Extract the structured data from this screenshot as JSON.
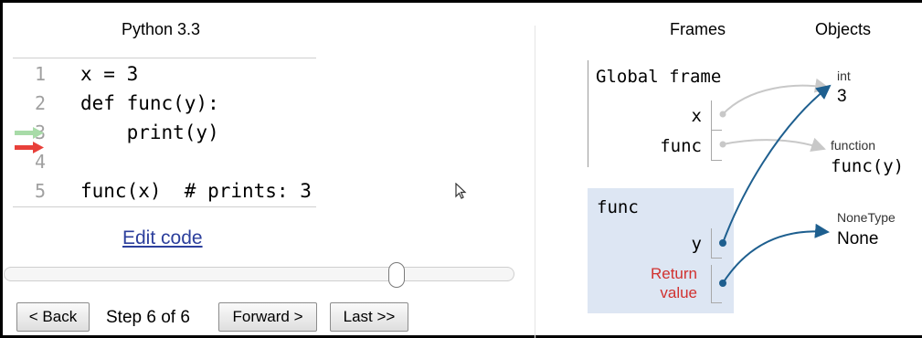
{
  "header": {
    "language": "Python 3.3",
    "frames_label": "Frames",
    "objects_label": "Objects"
  },
  "code": {
    "lines": [
      {
        "num": "1",
        "text": "x = 3"
      },
      {
        "num": "2",
        "text": "def func(y):"
      },
      {
        "num": "3",
        "text": "    print(y)"
      },
      {
        "num": "4",
        "text": ""
      },
      {
        "num": "5",
        "text": "func(x)  # prints: 3"
      }
    ],
    "prev_line_arrow_color": "#a8dba8",
    "current_line_arrow_color": "#e8403a"
  },
  "controls": {
    "edit_code": "Edit code",
    "back": "< Back",
    "step": "Step 6 of 6",
    "forward": "Forward >",
    "last": "Last >>",
    "slider_fraction": 1.0
  },
  "frames": {
    "global": {
      "title": "Global frame",
      "vars": [
        {
          "name": "x"
        },
        {
          "name": "func"
        }
      ]
    },
    "func": {
      "title": "func",
      "vars": [
        {
          "name": "y"
        }
      ],
      "return_line1": "Return",
      "return_line2": "value"
    }
  },
  "objects": {
    "int_obj": {
      "type": "int",
      "value": "3"
    },
    "function_obj": {
      "type": "function",
      "value": "func(y)"
    },
    "none_obj": {
      "type": "NoneType",
      "value": "None"
    }
  },
  "colors": {
    "active_arrow": "#1e5f8f",
    "inactive_arrow": "#c8c8c8",
    "func_frame_bg": "#dde6f3",
    "return_text": "#d1312f",
    "link": "#2c3f9c"
  }
}
